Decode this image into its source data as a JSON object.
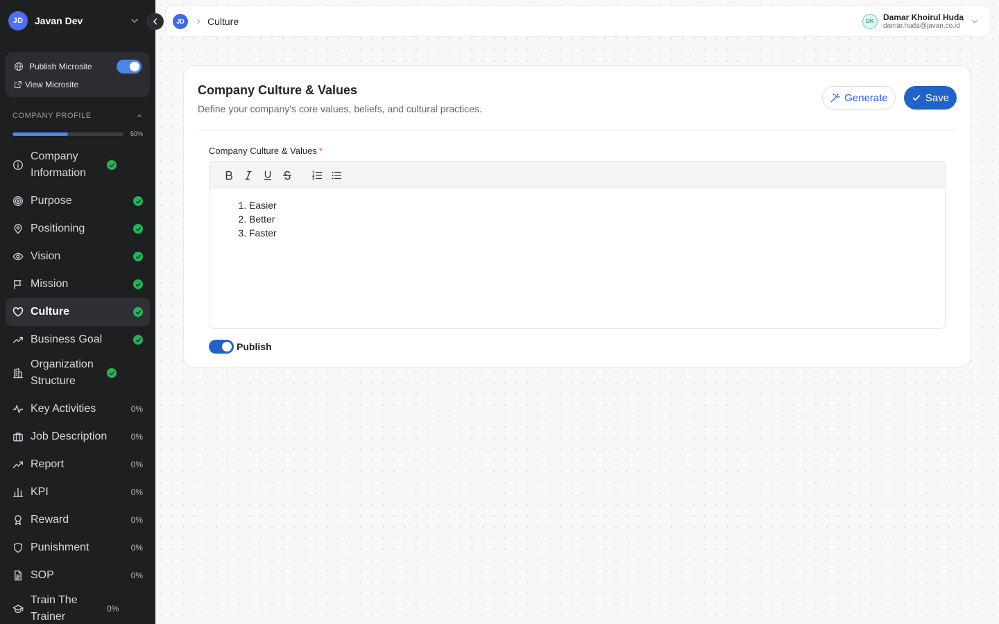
{
  "workspace": {
    "initials": "JD",
    "name": "Javan Dev"
  },
  "microsite": {
    "publish_label": "Publish Microsite",
    "publish_on": true,
    "view_label": "View Microsite"
  },
  "profile": {
    "section_title": "COMPANY PROFILE",
    "progress_pct": 50,
    "progress_text": "50%"
  },
  "nav": {
    "items": [
      {
        "label": "Company Information",
        "icon": "info-icon",
        "status": "done"
      },
      {
        "label": "Purpose",
        "icon": "target-icon",
        "status": "done"
      },
      {
        "label": "Positioning",
        "icon": "map-pin-icon",
        "status": "done"
      },
      {
        "label": "Vision",
        "icon": "eye-icon",
        "status": "done"
      },
      {
        "label": "Mission",
        "icon": "flag-icon",
        "status": "done"
      },
      {
        "label": "Culture",
        "icon": "heart-icon",
        "status": "done",
        "active": true
      },
      {
        "label": "Business Goal",
        "icon": "trending-up-icon",
        "status": "done"
      },
      {
        "label": "Organization Structure",
        "icon": "building-icon",
        "status": "done"
      },
      {
        "label": "Key Activities",
        "icon": "activity-icon",
        "status": "0%"
      },
      {
        "label": "Job Description",
        "icon": "briefcase-icon",
        "status": "0%"
      },
      {
        "label": "Report",
        "icon": "chart-line-icon",
        "status": "0%"
      },
      {
        "label": "KPI",
        "icon": "bar-chart-icon",
        "status": "0%"
      },
      {
        "label": "Reward",
        "icon": "award-icon",
        "status": "0%"
      },
      {
        "label": "Punishment",
        "icon": "shield-icon",
        "status": "0%"
      },
      {
        "label": "SOP",
        "icon": "file-text-icon",
        "status": "0%"
      },
      {
        "label": "Train The Trainer",
        "icon": "graduation-cap-icon",
        "status": "0%"
      }
    ]
  },
  "topbar": {
    "initials": "JD",
    "breadcrumb": "Culture",
    "user": {
      "initials": "DK",
      "name": "Damar Khoirul Huda",
      "email": "damar.huda@javan.co.id"
    }
  },
  "card": {
    "title": "Company Culture & Values",
    "description": "Define your company's core values, beliefs, and cultural practices.",
    "generate_label": "Generate",
    "save_label": "Save",
    "field_label": "Company Culture & Values",
    "required_mark": "*",
    "editor_items": [
      "Easier",
      "Better",
      "Faster"
    ],
    "publish_label": "Publish",
    "publish_on": true
  },
  "colors": {
    "accent": "#2163c9",
    "sidebar_bg": "#1e1f21",
    "success": "#22b45a"
  }
}
